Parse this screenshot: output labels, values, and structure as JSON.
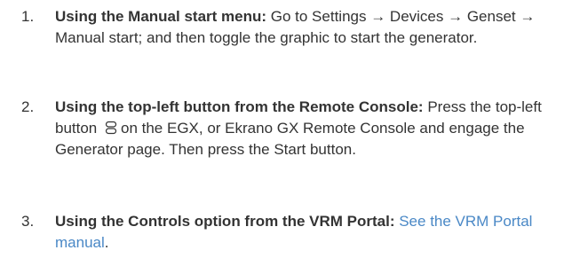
{
  "steps": [
    {
      "number": "1.",
      "title": "Using the Manual start menu:",
      "text": "Go to Settings → Devices → Genset → Manual start; and then toggle the graphic to start the generator."
    },
    {
      "number": "2.",
      "title": "Using the top-left button from the Remote Console:",
      "text_before": "Press the top-left button",
      "icon": "menu-button-icon",
      "text_after": "on the EGX, or Ekrano GX Remote Console and engage the Generator page. Then press the Start button."
    },
    {
      "number": "3.",
      "title": "Using the Controls option from the VRM Portal:",
      "link": "See the VRM Portal manual",
      "text_after": "."
    }
  ],
  "colors": {
    "text": "#333333",
    "link": "#4a88c6"
  }
}
